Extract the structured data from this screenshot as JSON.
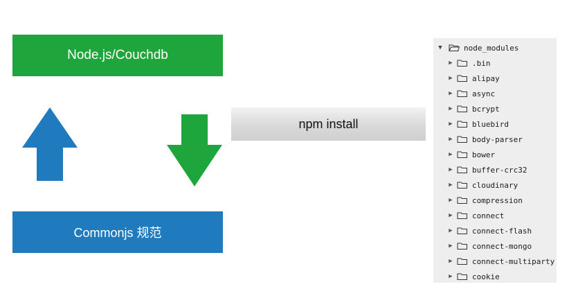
{
  "left_diagram": {
    "top_box_label": "Node.js/Couchdb",
    "bottom_box_label": "Commonjs 规范",
    "top_color": "#1ea53b",
    "bottom_color": "#1f7bbd"
  },
  "npm_bar": {
    "label": "npm install"
  },
  "file_tree": {
    "root": "node_modules",
    "items": [
      {
        "label": ".bin"
      },
      {
        "label": "alipay"
      },
      {
        "label": "async"
      },
      {
        "label": "bcrypt"
      },
      {
        "label": "bluebird"
      },
      {
        "label": "body-parser"
      },
      {
        "label": "bower"
      },
      {
        "label": "buffer-crc32"
      },
      {
        "label": "cloudinary"
      },
      {
        "label": "compression"
      },
      {
        "label": "connect"
      },
      {
        "label": "connect-flash"
      },
      {
        "label": "connect-mongo"
      },
      {
        "label": "connect-multiparty"
      },
      {
        "label": "cookie"
      }
    ]
  }
}
